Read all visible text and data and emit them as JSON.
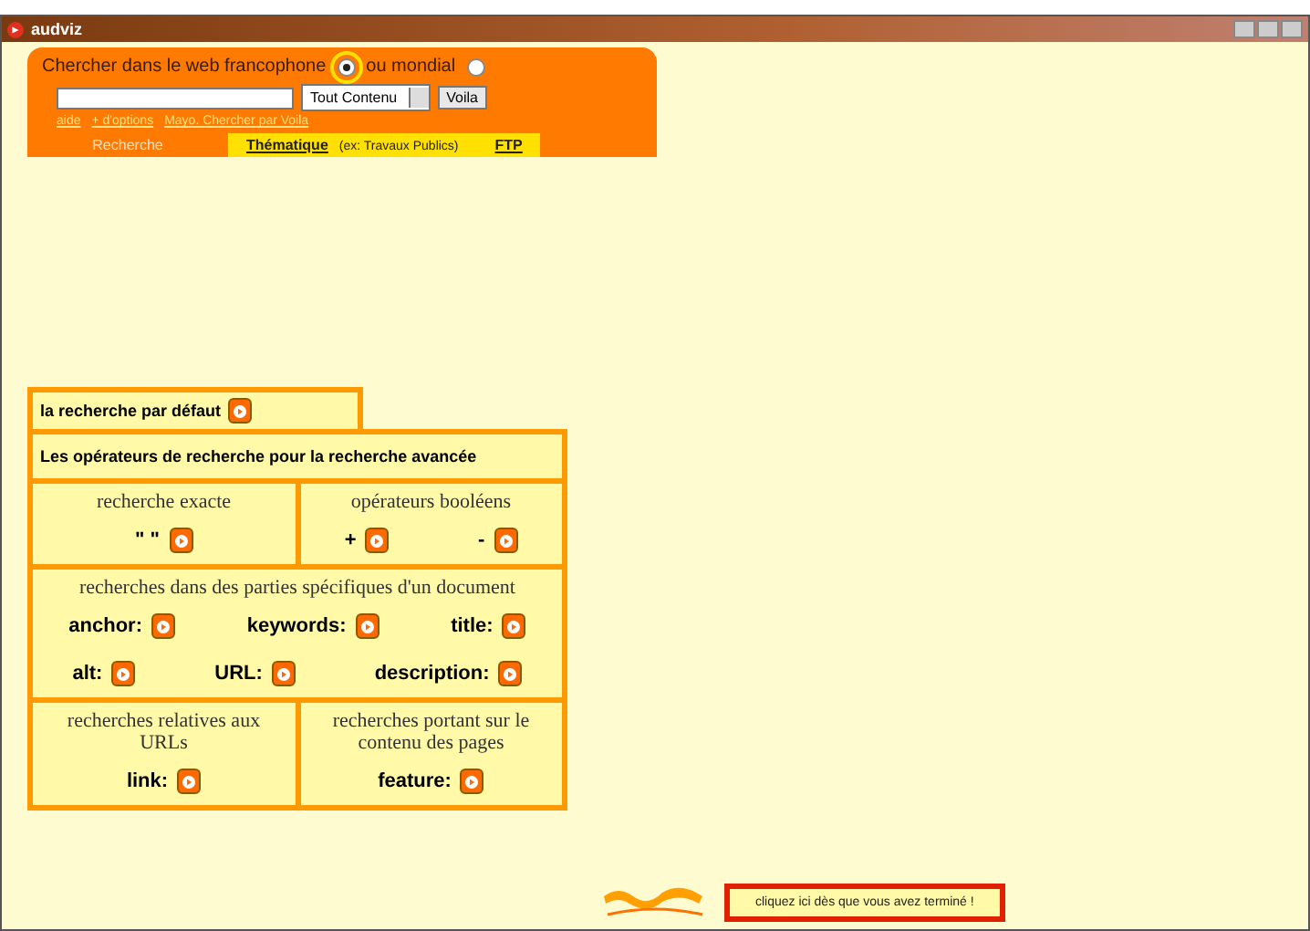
{
  "window": {
    "title": "audviz"
  },
  "search_panel": {
    "scope_options": [
      {
        "label": "Chercher dans le web francophone",
        "selected": true
      },
      {
        "label": "ou mondial",
        "selected": false
      }
    ],
    "dropdown": "Tout Contenu",
    "button": "Voila",
    "links": [
      "aide",
      "+ d'options",
      "Mayo. Chercher par Voila"
    ],
    "tabs": [
      {
        "label": "Recherche",
        "selected": true
      },
      {
        "label": "Thématique",
        "note": "(ex: Travaux Publics)",
        "selected": false
      },
      {
        "label": "FTP",
        "selected": false
      }
    ]
  },
  "tutorial": {
    "default_search": "la recherche par défaut",
    "heading": "Les opérateurs de recherche pour la recherche avancée",
    "sections": [
      {
        "title": "recherche exacte",
        "kind": "half",
        "rows": [
          [
            "\"  \""
          ]
        ]
      },
      {
        "title": "opérateurs booléens",
        "kind": "half",
        "rows": [
          [
            "+",
            "-"
          ]
        ]
      },
      {
        "title": "recherches dans des parties spécifiques d'un document",
        "kind": "full",
        "rows": [
          [
            "anchor:",
            "keywords:",
            "title:"
          ],
          [
            "alt:",
            "URL:",
            "description:"
          ]
        ]
      },
      {
        "title": "recherches relatives aux URLs",
        "kind": "half",
        "rows": [
          [
            "link:"
          ]
        ]
      },
      {
        "title": "recherches portant sur le contenu des pages",
        "kind": "half",
        "rows": [
          [
            "feature:"
          ]
        ]
      }
    ]
  },
  "done_note": "cliquez ici dès que vous avez terminé !"
}
